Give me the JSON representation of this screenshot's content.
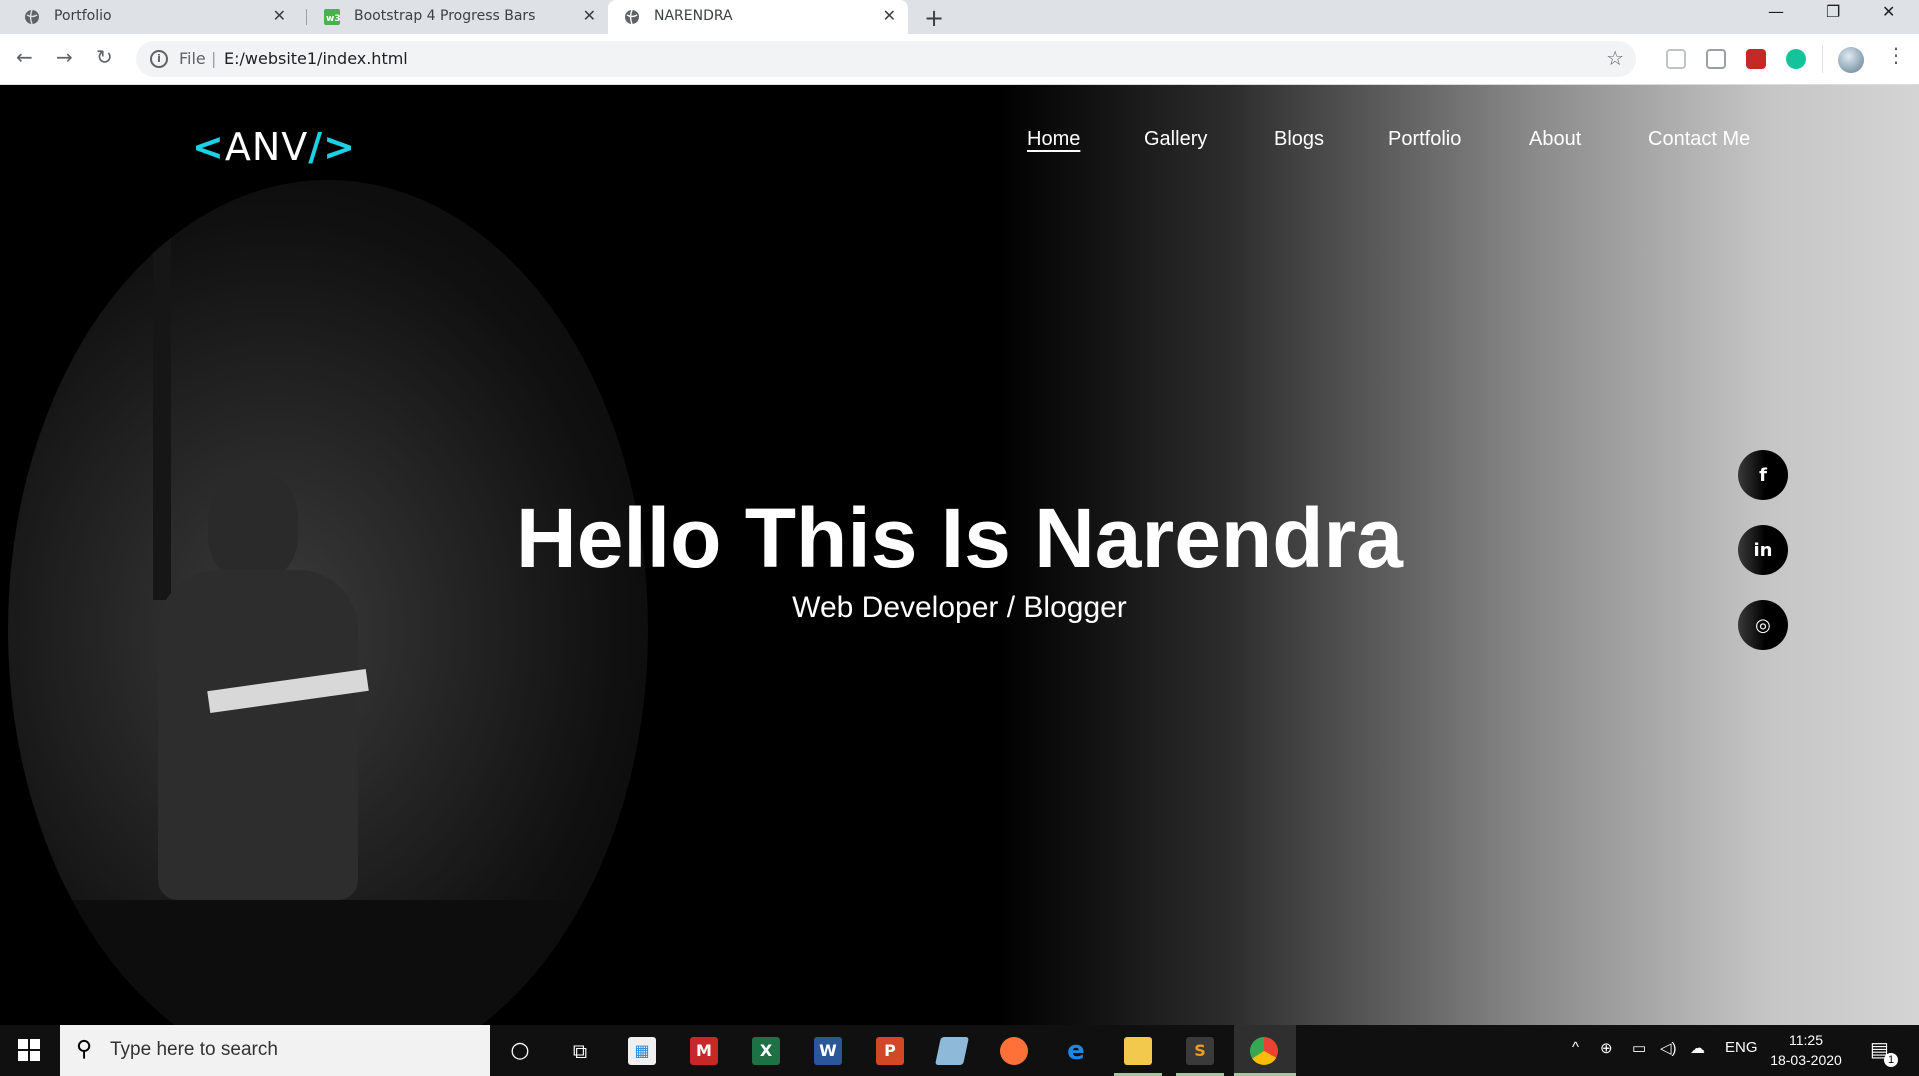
{
  "browser": {
    "tabs": [
      {
        "title": "Portfolio",
        "favicon": "globe-icon"
      },
      {
        "title": "Bootstrap 4 Progress Bars",
        "favicon": "w3-icon"
      },
      {
        "title": "NARENDRA",
        "favicon": "globe-icon",
        "active": true
      }
    ],
    "new_tab_symbol": "+",
    "url_scheme": "File",
    "url": "E:/website1/index.html"
  },
  "site": {
    "logo": {
      "open": "<",
      "text": "ANV",
      "close": "/>"
    },
    "nav": [
      "Home",
      "Gallery",
      "Blogs",
      "Portfolio",
      "About",
      "Contact Me"
    ],
    "active_nav": "Home",
    "hero_title": "Hello This Is Narendra",
    "hero_subtitle": "Web Developer / Blogger",
    "social": [
      {
        "name": "facebook-icon",
        "glyph": "f"
      },
      {
        "name": "linkedin-icon",
        "glyph": "in"
      },
      {
        "name": "instagram-icon",
        "glyph": "◎"
      }
    ],
    "accent_color": "#1ad1e5"
  },
  "taskbar": {
    "search_placeholder": "Type here to search",
    "language": "ENG",
    "time": "11:25",
    "date": "18-03-2020",
    "notification_count": "1"
  }
}
